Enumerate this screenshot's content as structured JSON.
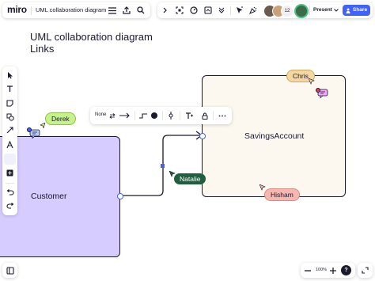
{
  "app": {
    "logo": "miro",
    "board_title": "UML collaboration diagram"
  },
  "header": {
    "present_label": "Present",
    "share_label": "Share",
    "participant_count": "12"
  },
  "canvas": {
    "title_line1": "UML collaboration diagram",
    "title_line2": "Links"
  },
  "shapes": {
    "customer_label": "Customer",
    "savings_label": "SavingsAccount"
  },
  "connector_toolbar": {
    "line_start_label": "None"
  },
  "cursors": [
    {
      "name": "Derek",
      "color": "#c6f28a",
      "text_color": "#1a1a2e"
    },
    {
      "name": "Chris",
      "color": "#f4d7a1",
      "text_color": "#1a1a2e"
    },
    {
      "name": "Natalie",
      "color": "#1f5f3f",
      "text_color": "#ffffff"
    },
    {
      "name": "Hisham",
      "color": "#f6b7b0",
      "text_color": "#1a1a2e"
    }
  ],
  "zoom": {
    "level": "100%"
  },
  "colors": {
    "accent": "#4262ff",
    "customer_fill": "#d7ccff",
    "savings_fill": "#fcf8ef",
    "connector": "#1a1a2e"
  }
}
